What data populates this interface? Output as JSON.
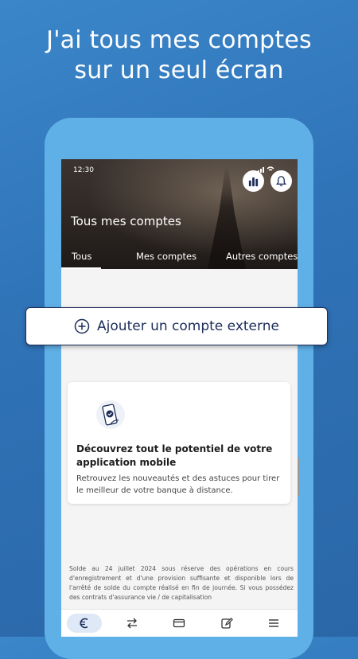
{
  "promo": {
    "line1": "J'ai tous mes comptes",
    "line2": "sur un seul écran"
  },
  "status_bar": {
    "time": "12:30"
  },
  "header": {
    "title": "Tous mes comptes",
    "icons": [
      "stats-icon",
      "bell-icon"
    ]
  },
  "tabs": [
    {
      "label": "Tous",
      "active": true
    },
    {
      "label": "Mes comptes",
      "active": false
    },
    {
      "label": "Autres comptes",
      "active": false
    }
  ],
  "add_account": {
    "label": "Ajouter un compte externe",
    "icon": "plus-circle-icon"
  },
  "promo_card": {
    "icon": "phone-check-icon",
    "heading": "Découvrez tout le potentiel de votre application mobile",
    "description": "Retrouvez les nouveautés et des astuces pour tirer le meilleur de votre banque à distance."
  },
  "legal_text": "Solde au 24 juillet 2024 sous réserve des opérations en cours d'enregistrement et d'une provision suffisante et disponible lors de l'arrêté de solde du compte réalisé en fin de journée. Si vous possédez des contrats d'assurance vie / de capitalisation",
  "bottom_nav": [
    {
      "icon": "euro-icon",
      "active": true
    },
    {
      "icon": "transfer-icon",
      "active": false
    },
    {
      "icon": "card-icon",
      "active": false
    },
    {
      "icon": "edit-icon",
      "active": false
    },
    {
      "icon": "menu-icon",
      "active": false
    }
  ],
  "colors": {
    "background": "#2f72b6",
    "phone_frame": "#5fb0e6",
    "primary": "#1c2d5a",
    "nav_active_bg": "#dfe8f6"
  }
}
